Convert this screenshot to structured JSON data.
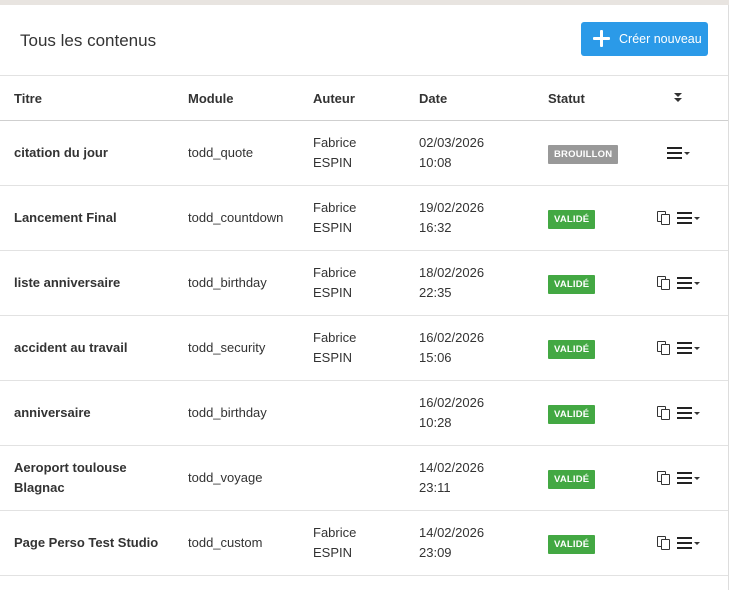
{
  "header": {
    "title": "Tous les contenus",
    "create_button_label": "Créer nouveau"
  },
  "table": {
    "columns": {
      "title": "Titre",
      "module": "Module",
      "author": "Auteur",
      "date": "Date",
      "status": "Statut"
    },
    "rows": [
      {
        "title": "citation du jour",
        "module": "todd_quote",
        "author": "Fabrice\nESPIN",
        "date": "02/03/2026\n10:08",
        "status": "BROUILLON",
        "status_kind": "draft",
        "copy_action": false
      },
      {
        "title": "Lancement Final",
        "module": "todd_countdown",
        "author": "Fabrice\nESPIN",
        "date": "19/02/2026\n16:32",
        "status": "VALIDÉ",
        "status_kind": "valid",
        "copy_action": true
      },
      {
        "title": "liste anniversaire",
        "module": "todd_birthday",
        "author": "Fabrice\nESPIN",
        "date": "18/02/2026\n22:35",
        "status": "VALIDÉ",
        "status_kind": "valid",
        "copy_action": true
      },
      {
        "title": "accident au travail",
        "module": "todd_security",
        "author": "Fabrice\nESPIN",
        "date": "16/02/2026\n15:06",
        "status": "VALIDÉ",
        "status_kind": "valid",
        "copy_action": true
      },
      {
        "title": "anniversaire",
        "module": "todd_birthday",
        "author": "",
        "date": "16/02/2026\n10:28",
        "status": "VALIDÉ",
        "status_kind": "valid",
        "copy_action": true
      },
      {
        "title": "Aeroport toulouse\nBlagnac",
        "module": "todd_voyage",
        "author": "",
        "date": "14/02/2026\n23:11",
        "status": "VALIDÉ",
        "status_kind": "valid",
        "copy_action": true
      },
      {
        "title": "Page Perso Test Studio",
        "module": "todd_custom",
        "author": "Fabrice\nESPIN",
        "date": "14/02/2026\n23:09",
        "status": "VALIDÉ",
        "status_kind": "valid",
        "copy_action": true
      }
    ]
  },
  "icons": {
    "create": "plus-icon",
    "sort": "sort-down-icon",
    "copy": "copy-icon",
    "menu": "menu-dropdown-icon"
  },
  "colors": {
    "primary": "#2b9ae8",
    "valid": "#43a843",
    "draft": "#999999"
  }
}
